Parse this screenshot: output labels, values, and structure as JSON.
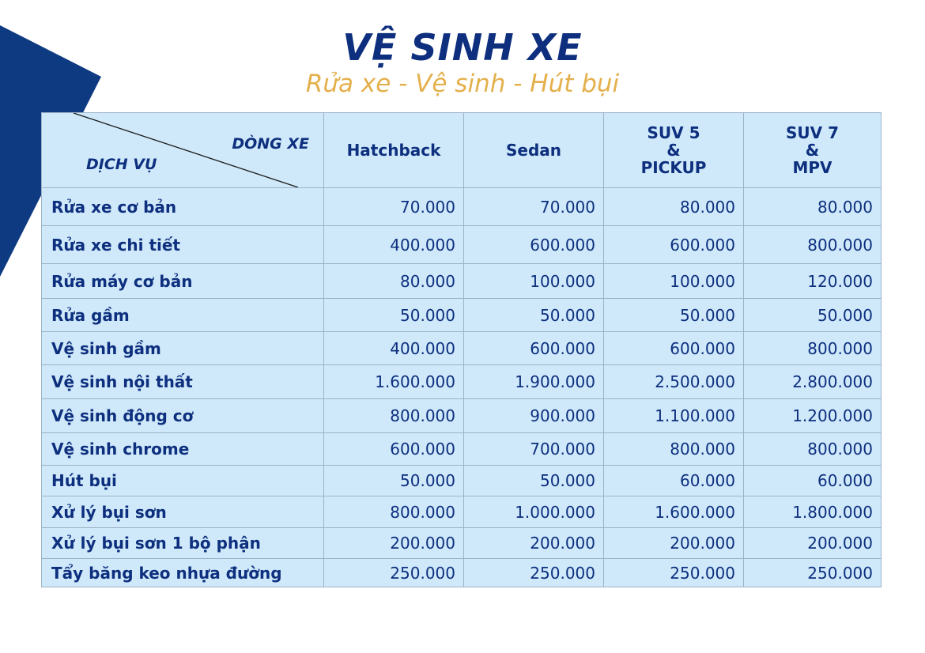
{
  "title": "VỆ SINH XE",
  "subtitle": "Rửa xe - Vệ sinh - Hút bụi",
  "colors": {
    "brand_blue": "#0d2f7e",
    "accent_gold": "#e4b04c",
    "cell_background": "#cfe9fa",
    "corner_shape": "#0e3a82"
  },
  "table": {
    "corner_top_label": "DÒNG XE",
    "corner_bottom_label": "DỊCH VỤ",
    "columns": [
      {
        "lines": [
          "Hatchback"
        ]
      },
      {
        "lines": [
          "Sedan"
        ]
      },
      {
        "lines": [
          "SUV 5",
          "&",
          "PICKUP"
        ]
      },
      {
        "lines": [
          "SUV 7",
          "&",
          "MPV"
        ]
      }
    ],
    "rows": [
      {
        "service": "Rửa xe cơ bản",
        "prices": [
          "70.000",
          "70.000",
          "80.000",
          "80.000"
        ]
      },
      {
        "service": "Rửa xe chi tiết",
        "prices": [
          "400.000",
          "600.000",
          "600.000",
          "800.000"
        ]
      },
      {
        "service": "Rửa máy cơ bản",
        "prices": [
          "80.000",
          "100.000",
          "100.000",
          "120.000"
        ]
      },
      {
        "service": "Rửa gầm",
        "prices": [
          "50.000",
          "50.000",
          "50.000",
          "50.000"
        ]
      },
      {
        "service": "Vệ sinh gầm",
        "prices": [
          "400.000",
          "600.000",
          "600.000",
          "800.000"
        ]
      },
      {
        "service": "Vệ sinh nội thất",
        "prices": [
          "1.600.000",
          "1.900.000",
          "2.500.000",
          "2.800.000"
        ]
      },
      {
        "service": "Vệ sinh động cơ",
        "prices": [
          "800.000",
          "900.000",
          "1.100.000",
          "1.200.000"
        ]
      },
      {
        "service": "Vệ sinh chrome",
        "prices": [
          "600.000",
          "700.000",
          "800.000",
          "800.000"
        ]
      },
      {
        "service": "Hút bụi",
        "prices": [
          "50.000",
          "50.000",
          "60.000",
          "60.000"
        ]
      },
      {
        "service": "Xử lý bụi sơn",
        "prices": [
          "800.000",
          "1.000.000",
          "1.600.000",
          "1.800.000"
        ]
      },
      {
        "service": "Xử lý bụi sơn 1 bộ phận",
        "prices": [
          "200.000",
          "200.000",
          "200.000",
          "200.000"
        ]
      },
      {
        "service": "Tẩy băng keo nhựa đường",
        "prices": [
          "250.000",
          "250.000",
          "250.000",
          "250.000"
        ]
      }
    ]
  }
}
